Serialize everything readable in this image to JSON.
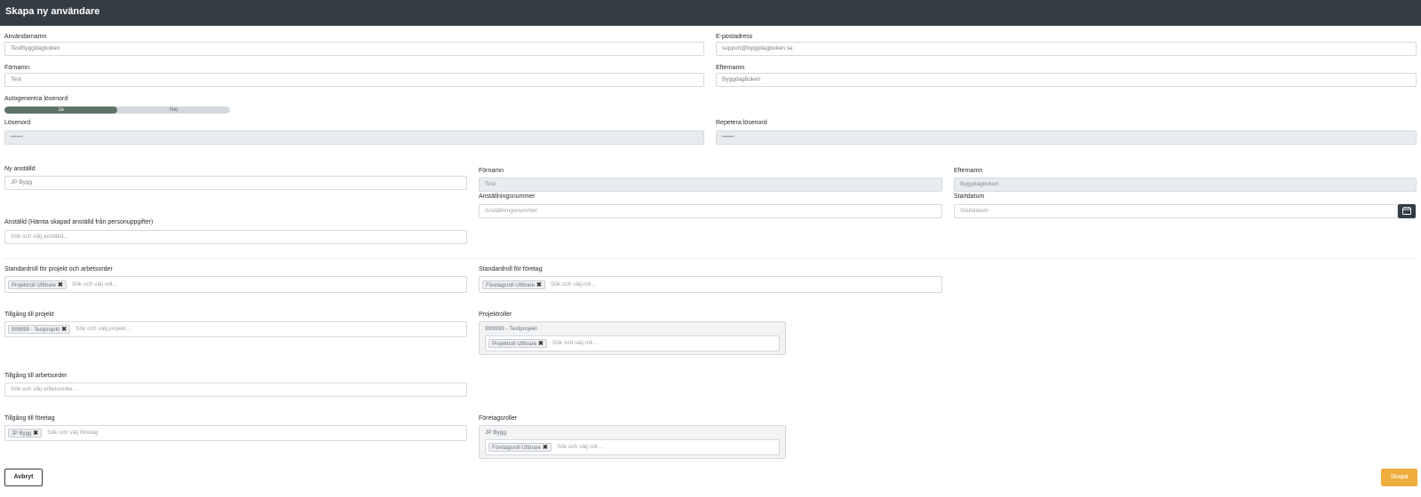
{
  "header": {
    "title": "Skapa ny användare"
  },
  "account": {
    "username": {
      "label": "Användarnamn",
      "value": "TestByggdagboken"
    },
    "email": {
      "label": "E-postadress",
      "value": "support@byggdagboken.se"
    },
    "firstname": {
      "label": "Förnamn",
      "value": "Test"
    },
    "lastname": {
      "label": "Efternamn",
      "value": "Byggdagboken"
    },
    "autogen": {
      "label": "Autogenerera lösenord",
      "yes": "Ja",
      "no": "Nej",
      "selected": "Ja"
    },
    "password": {
      "label": "Lösenord",
      "value": "••••••"
    },
    "password_repeat": {
      "label": "Repetera lösenord",
      "value": "••••••"
    }
  },
  "employee": {
    "new_employee": {
      "label": "Ny anställd",
      "value": "JP Bygg"
    },
    "firstname": {
      "label": "Förnamn",
      "value": "Test"
    },
    "lastname": {
      "label": "Efternamn",
      "value": "Byggdagboken"
    },
    "employee_number": {
      "label": "Anställningsnummer",
      "placeholder": "Anställningsnummer"
    },
    "start_date": {
      "label": "Startdatum",
      "placeholder": "Startdatum"
    },
    "existing": {
      "label": "Anställd (Hämta skapad anställd från personuppgifter)",
      "placeholder": "Sök och välj anställd..."
    }
  },
  "roles": {
    "default_project_role": {
      "label": "Standardroll för projekt och arbetsorder",
      "tag": "Projektroll Utförare",
      "placeholder": "Sök och välj roll..."
    },
    "default_company_role": {
      "label": "Standardroll för företag",
      "tag": "Företagsroll Utförare",
      "placeholder": "Sök och välj roll..."
    }
  },
  "access": {
    "projects": {
      "label": "Tillgång till projekt",
      "tag": "999999 - Testprojekt",
      "placeholder": "Sök och välj projekt..."
    },
    "project_roles": {
      "label": "Projektroller",
      "item_title": "999999 - Testprojekt",
      "tag": "Projektroll Utförare",
      "placeholder": "Sök och välj roll..."
    },
    "workorders": {
      "label": "Tillgång till arbetsorder",
      "placeholder": "Sök och välj arbetsorder..."
    },
    "companies": {
      "label": "Tillgång till företag",
      "tag": "JP Bygg",
      "placeholder": "Sök och välj företag"
    },
    "company_roles": {
      "label": "Företagsroller",
      "item_title": "JP Bygg",
      "tag": "Företagsroll Utförare",
      "placeholder": "Sök och välj roll..."
    }
  },
  "actions": {
    "cancel": "Avbryt",
    "create": "Skapa"
  },
  "colors": {
    "header_bg": "#343d44",
    "toggle_active": "#5f7366",
    "create_button": "#efad3e"
  }
}
